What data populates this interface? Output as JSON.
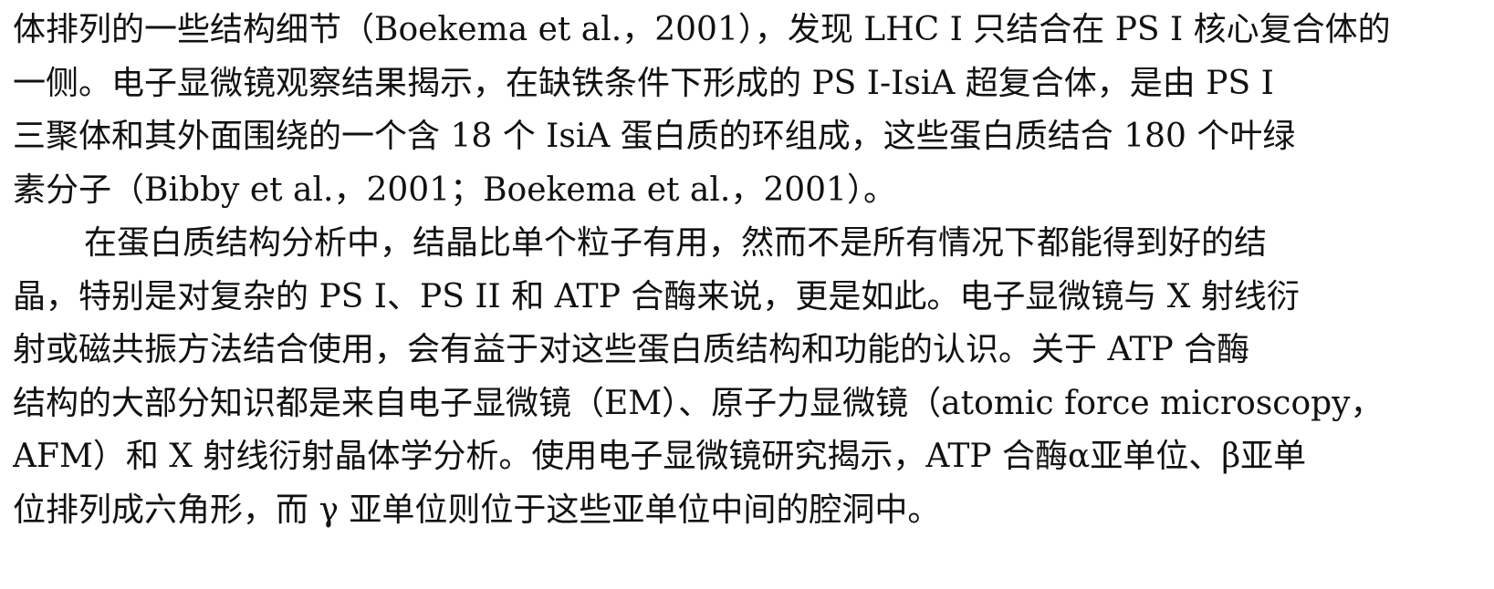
{
  "paragraph1": {
    "lines": [
      "体排列的一些结构细节（Boekema et al.，2001），发现 LHC I 只结合在 PS I 核心复合体的",
      "一侧。电子显微镜观察结果揭示，在缺铁条件下形成的 PS I-IsiA 超复合体，是由 PS I",
      "三聚体和其外面围绕的一个含 18 个 IsiA 蛋白质的环组成，这些蛋白质结合 180 个叶绿",
      "素分子（Bibby et al.，2001；Boekema et al.，2001）。"
    ]
  },
  "paragraph2": {
    "lines": [
      "在蛋白质结构分析中，结晶比单个粒子有用，然而不是所有情况下都能得到好的结",
      "晶，特别是对复杂的 PS I、PS II 和 ATP 合酶来说，更是如此。电子显微镜与 X 射线衍",
      "射或磁共振方法结合使用，会有益于对这些蛋白质结构和功能的认识。关于 ATP 合酶",
      "结构的大部分知识都是来自电子显微镜（EM）、原子力显微镜（atomic force microscopy，",
      "AFM）和 X 射线衍射晶体学分析。使用电子显微镜研究揭示，ATP 合酶α亚单位、β亚单",
      "位排列成六角形，而 γ 亚单位则位于这些亚单位中间的腔洞中。"
    ]
  }
}
